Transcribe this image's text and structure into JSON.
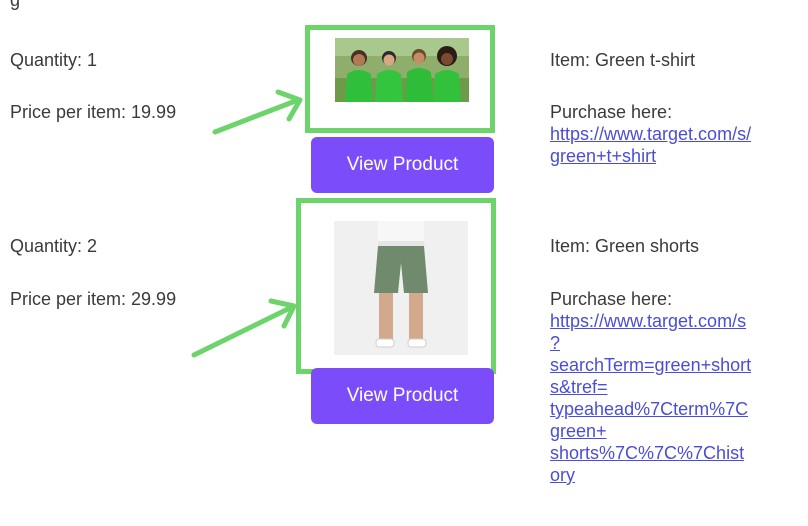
{
  "top_partial_text": "g   ",
  "items": [
    {
      "quantity": "Quantity: 1",
      "price": "Price per item: 19.99",
      "item": "Item: Green t-shirt",
      "purchase_label": "Purchase here:",
      "link_lines": [
        "https://www.target.com/s/",
        "green+t+shirt"
      ],
      "image_name": "green t-shirt photo",
      "button_label": "View Product"
    },
    {
      "quantity": "Quantity: 2",
      "price": "Price per item: 29.99",
      "item": "Item: Green shorts",
      "purchase_label": "Purchase here:",
      "link_lines": [
        "https://www.target.com/s",
        "?",
        "searchTerm=green+short",
        "s&tref=",
        "typeahead%7Cterm%7C",
        "green+",
        "shorts%7C%7C%7Chist",
        "ory"
      ],
      "image_name": "green shorts photo",
      "button_label": "View Product"
    }
  ],
  "colors": {
    "highlight": "#6cd46a",
    "button": "#7b4dfa",
    "link": "#4a4dd8"
  }
}
